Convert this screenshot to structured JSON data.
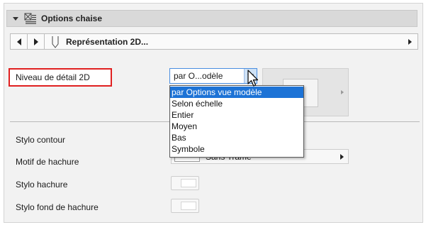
{
  "header": {
    "title": "Options chaise"
  },
  "nav": {
    "section_title": "Représentation 2D..."
  },
  "lod": {
    "label": "Niveau de détail 2D",
    "value": "par O...odèle",
    "options": [
      "par Options vue modèle",
      "Selon échelle",
      "Entier",
      "Moyen",
      "Bas",
      "Symbole"
    ],
    "selected_index": 0
  },
  "fields": {
    "stylo_contour": "Stylo contour",
    "motif_hachure": "Motif de hachure",
    "motif_hachure_value": "Sans Trame*",
    "stylo_hachure": "Stylo hachure",
    "stylo_fond_hachure": "Stylo fond de hachure"
  },
  "colors": {
    "highlight_border": "#e02020",
    "selection": "#1d73d6",
    "combo_border": "#4a8ee0"
  },
  "icons": [
    "disclosure-triangle-icon",
    "chair-settings-icon",
    "arrow-left-icon",
    "arrow-right-icon",
    "pen-icon",
    "chevron-down-icon",
    "mouse-pointer-icon"
  ]
}
